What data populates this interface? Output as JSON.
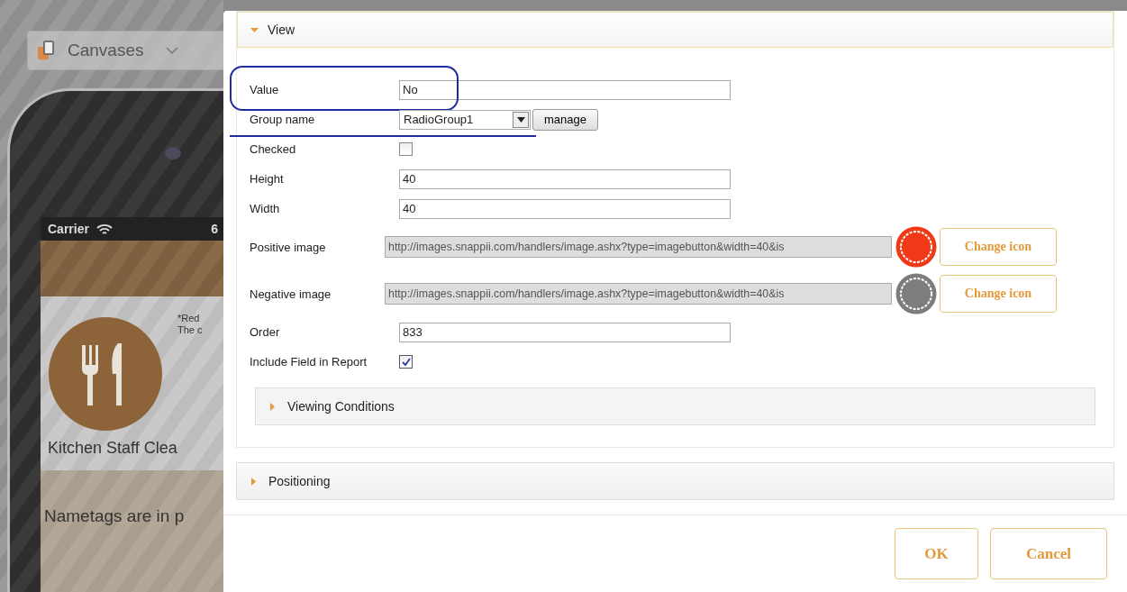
{
  "background": {
    "toolbar": {
      "label": "Canvases"
    },
    "phone": {
      "carrier": "Carrier",
      "time": "6",
      "note_lines": [
        "*Red",
        "The c"
      ],
      "item_title": "Kitchen Staff Clea",
      "item_text": "Nametags are in p"
    }
  },
  "dialog": {
    "view_section": {
      "title": "View",
      "expanded": true,
      "fields": [
        {
          "kind": "text",
          "label": "Value",
          "value": "No",
          "circled": true
        },
        {
          "kind": "select",
          "label": "Group name",
          "value": "RadioGroup1",
          "button": "manage",
          "underlined": true
        },
        {
          "kind": "checkbox",
          "label": "Checked",
          "checked": false
        },
        {
          "kind": "text",
          "label": "Height",
          "value": "40"
        },
        {
          "kind": "text",
          "label": "Width",
          "value": "40"
        },
        {
          "kind": "image",
          "label": "Positive image",
          "value": "http://images.snappii.com/handlers/image.ashx?type=imagebutton&width=40&is",
          "color": "#f03a17",
          "button": "Change icon"
        },
        {
          "kind": "image",
          "label": "Negative image",
          "value": "http://images.snappii.com/handlers/image.ashx?type=imagebutton&width=40&is",
          "color": "#7d7d7d",
          "button": "Change icon"
        },
        {
          "kind": "text",
          "label": "Order",
          "value": "833"
        },
        {
          "kind": "checkbox",
          "label": "Include Field in Report",
          "checked": true
        }
      ],
      "subsection": {
        "title": "Viewing Conditions",
        "expanded": false
      }
    },
    "positioning": {
      "title": "Positioning",
      "expanded": false
    },
    "buttons": [
      "OK",
      "Cancel"
    ]
  }
}
